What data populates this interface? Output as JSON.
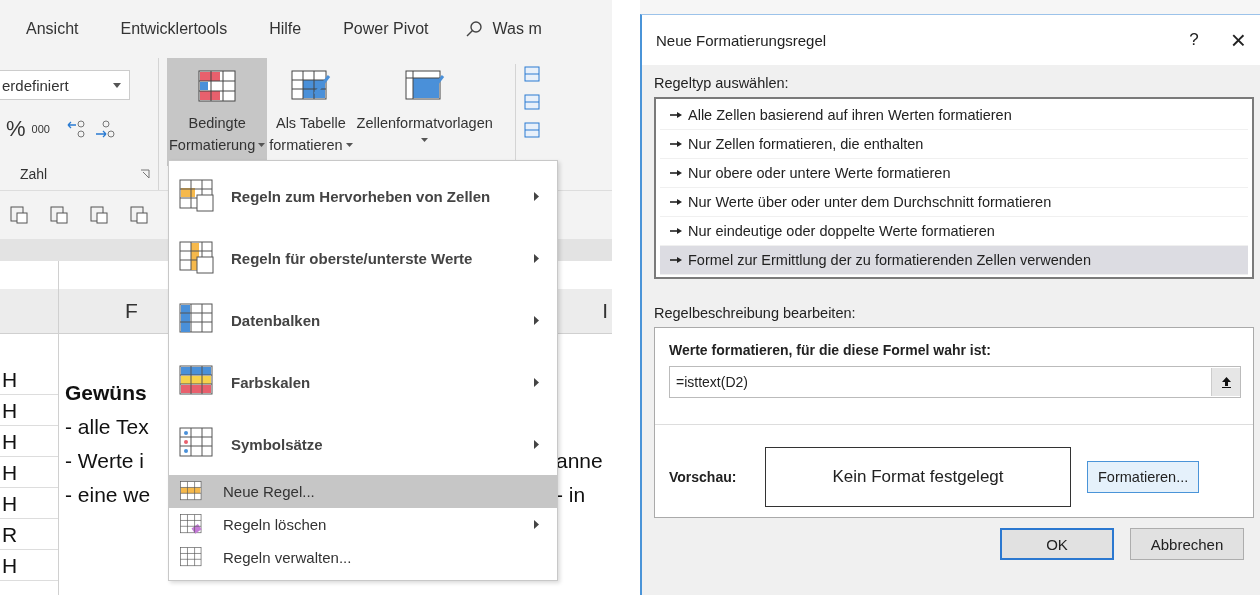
{
  "excel": {
    "tabs": [
      {
        "label": "Ansicht"
      },
      {
        "label": "Entwicklertools"
      },
      {
        "label": "Hilfe"
      },
      {
        "label": "Power Pivot"
      }
    ],
    "tell_me": "Was m",
    "number_format": "erdefiniert",
    "number_buttons": [
      "%",
      "000"
    ],
    "number_group_label": "Zahl",
    "style_buttons": [
      {
        "kind": "conditional",
        "lines": [
          "Bedingte",
          "Formatierung"
        ],
        "dropdown": true,
        "selected": true
      },
      {
        "kind": "table",
        "lines": [
          "Als Tabelle",
          "formatieren"
        ],
        "dropdown": true,
        "selected": false
      },
      {
        "kind": "cellstyle",
        "lines": [
          "Zellenformatvorlagen"
        ],
        "dropdown": true,
        "selected": false
      }
    ],
    "sheet": {
      "column_header": "F",
      "column_header_right": "I",
      "column_a": [
        "H",
        "H",
        "H",
        "H",
        "H",
        "R",
        "H"
      ],
      "text_lines": [
        {
          "text": "Gewüns",
          "bold": true
        },
        {
          "text": "- alle Tex",
          "bold": false
        },
        {
          "text": "- Werte i",
          "bold": false
        },
        {
          "text": "- eine we",
          "bold": false
        }
      ],
      "right_fragments": [
        "anne",
        "- in"
      ]
    },
    "menu": [
      {
        "kind": "large",
        "label": "Regeln zum Hervorheben von Zellen",
        "submenu": true,
        "selected": false
      },
      {
        "kind": "large",
        "label": "Regeln für oberste/unterste Werte",
        "submenu": true,
        "selected": false
      },
      {
        "kind": "large",
        "label": "Datenbalken",
        "submenu": true,
        "selected": false
      },
      {
        "kind": "large",
        "label": "Farbskalen",
        "submenu": true,
        "selected": false
      },
      {
        "kind": "large",
        "label": "Symbolsätze",
        "submenu": true,
        "selected": false
      },
      {
        "kind": "small",
        "label": "Neue Regel...",
        "submenu": false,
        "selected": true
      },
      {
        "kind": "small",
        "label": "Regeln löschen",
        "submenu": true,
        "selected": false
      },
      {
        "kind": "small",
        "label": "Regeln verwalten...",
        "submenu": false,
        "selected": false
      }
    ]
  },
  "dialog": {
    "title": "Neue Formatierungsregel",
    "help": "?",
    "close": "×",
    "rule_type_label": "Regeltyp auswählen:",
    "rule_types": [
      {
        "label": "Alle Zellen basierend auf ihren Werten formatieren",
        "selected": false
      },
      {
        "label": "Nur Zellen formatieren, die enthalten",
        "selected": false
      },
      {
        "label": "Nur obere oder untere Werte formatieren",
        "selected": false
      },
      {
        "label": "Nur Werte über oder unter dem Durchschnitt formatieren",
        "selected": false
      },
      {
        "label": "Nur eindeutige oder doppelte Werte formatieren",
        "selected": false
      },
      {
        "label": "Formel zur Ermittlung der zu formatierenden Zellen verwenden",
        "selected": true
      }
    ],
    "description_label": "Regelbeschreibung bearbeiten:",
    "formula_label": "Werte formatieren, für die diese Formel wahr ist:",
    "formula_value": "=isttext(D2)",
    "preview_label": "Vorschau:",
    "preview_text": "Kein Format festgelegt",
    "format_button": "Formatieren...",
    "buttons": [
      {
        "label": "OK",
        "default": true
      },
      {
        "label": "Abbrechen",
        "default": false
      }
    ]
  }
}
